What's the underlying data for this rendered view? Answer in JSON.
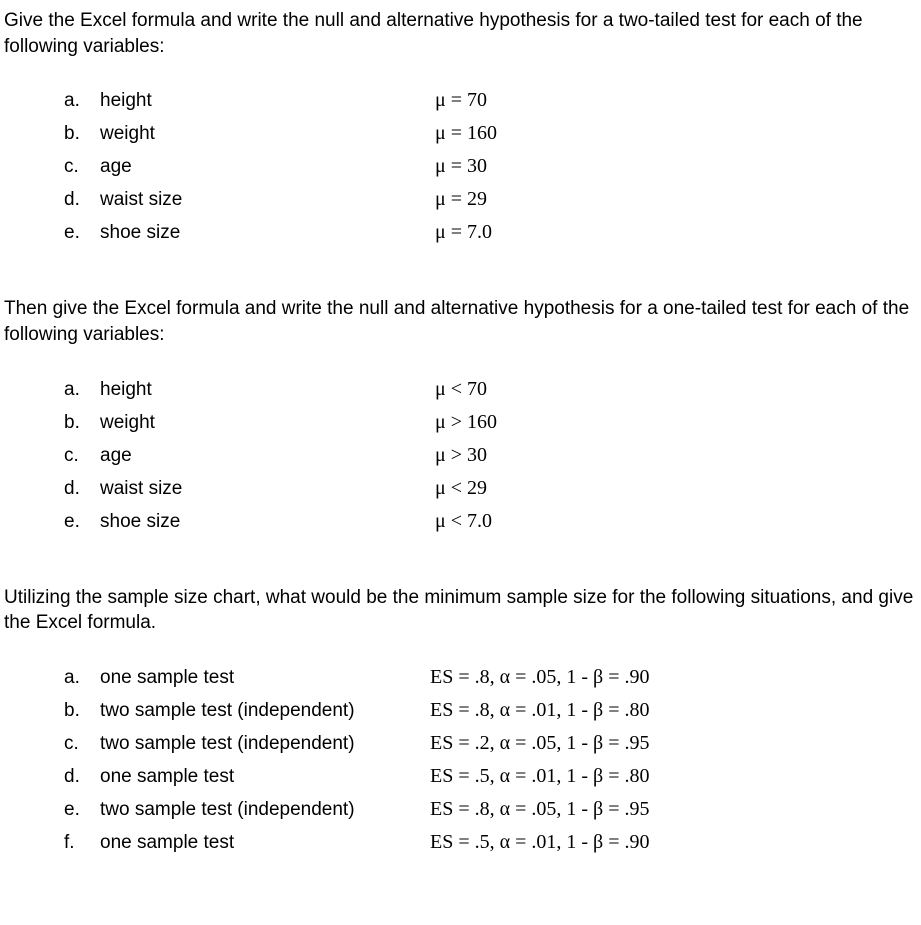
{
  "section1": {
    "intro": "Give the Excel formula and write the null and alternative hypothesis for a two-tailed test for each of the following variables:",
    "items": [
      {
        "letter": "a.",
        "label": "height",
        "value": "μ = 70"
      },
      {
        "letter": "b.",
        "label": "weight",
        "value": "μ = 160"
      },
      {
        "letter": "c.",
        "label": "age",
        "value": "μ = 30"
      },
      {
        "letter": "d.",
        "label": "waist size",
        "value": "μ = 29"
      },
      {
        "letter": "e.",
        "label": "shoe size",
        "value": "μ = 7.0"
      }
    ]
  },
  "section2": {
    "intro": "Then give the Excel formula and write the null and alternative hypothesis for a one-tailed test for each of the following variables:",
    "items": [
      {
        "letter": "a.",
        "label": "height",
        "value": "μ < 70"
      },
      {
        "letter": "b.",
        "label": "weight",
        "value": "μ > 160"
      },
      {
        "letter": "c.",
        "label": "age",
        "value": "μ > 30"
      },
      {
        "letter": "d.",
        "label": "waist size",
        "value": "μ < 29"
      },
      {
        "letter": "e.",
        "label": "shoe size",
        "value": "μ < 7.0"
      }
    ]
  },
  "section3": {
    "intro": "Utilizing the sample size chart, what would be the minimum sample size for the following situations, and give the Excel formula.",
    "items": [
      {
        "letter": "a.",
        "label": "one sample test",
        "value": "ES = .8, α = .05, 1 -   β = .90"
      },
      {
        "letter": "b.",
        "label": "two sample test (independent)",
        "value": "ES = .8, α = .01, 1 -   β = .80"
      },
      {
        "letter": "c.",
        "label": "two sample test (independent)",
        "value": "ES = .2, α = .05, 1 -   β = .95"
      },
      {
        "letter": "d.",
        "label": "one sample test",
        "value": "ES = .5, α = .01, 1 -   β = .80"
      },
      {
        "letter": "e.",
        "label": "two sample test (independent)",
        "value": "ES = .8, α = .05, 1 -   β = .95"
      },
      {
        "letter": "f.",
        "label": "one sample test",
        "value": "ES = .5, α = .01, 1 -   β = .90"
      }
    ]
  }
}
